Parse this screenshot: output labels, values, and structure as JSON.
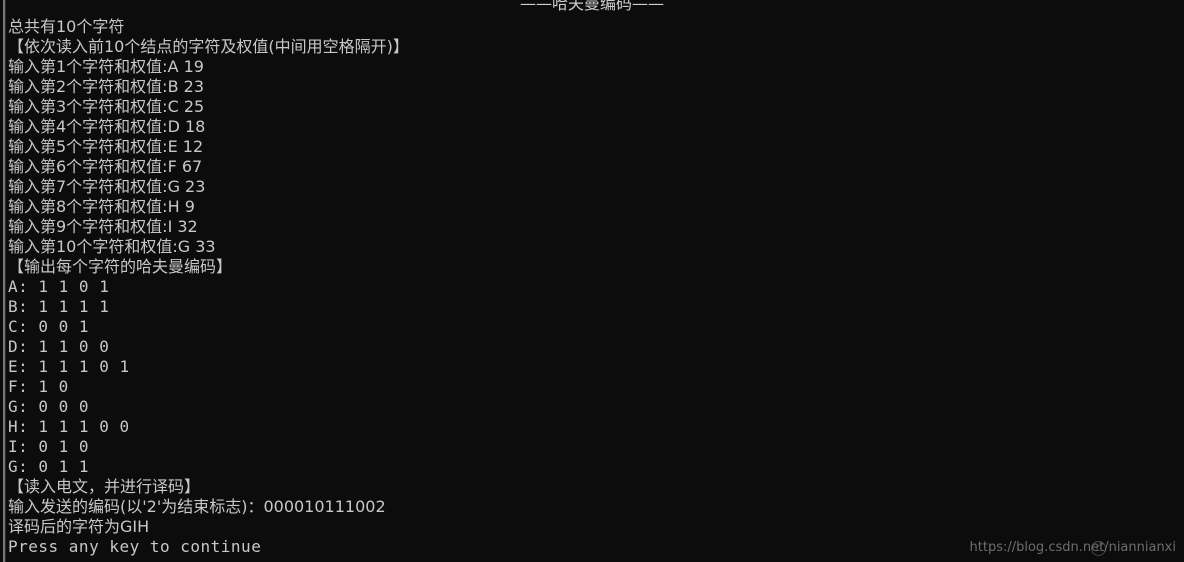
{
  "console": {
    "title": "——哈夫曼编码——",
    "background_color": "#0c0c0c",
    "text_color": "#c8c8c8",
    "lines": [
      {
        "text": "总共有10个字符",
        "mono": false
      },
      {
        "text": "【依次读入前10个结点的字符及权值(中间用空格隔开)】",
        "mono": false
      },
      {
        "text": "输入第1个字符和权值:A 19",
        "mono": false
      },
      {
        "text": "输入第2个字符和权值:B 23",
        "mono": false
      },
      {
        "text": "输入第3个字符和权值:C 25",
        "mono": false
      },
      {
        "text": "输入第4个字符和权值:D 18",
        "mono": false
      },
      {
        "text": "输入第5个字符和权值:E 12",
        "mono": false
      },
      {
        "text": "输入第6个字符和权值:F 67",
        "mono": false
      },
      {
        "text": "输入第7个字符和权值:G 23",
        "mono": false
      },
      {
        "text": "输入第8个字符和权值:H 9",
        "mono": false
      },
      {
        "text": "输入第9个字符和权值:I 32",
        "mono": false
      },
      {
        "text": "输入第10个字符和权值:G 33",
        "mono": false
      },
      {
        "text": "【输出每个字符的哈夫曼编码】",
        "mono": false
      },
      {
        "text": "A: 1 1 0 1",
        "mono": true
      },
      {
        "text": "B: 1 1 1 1",
        "mono": true
      },
      {
        "text": "C: 0 0 1",
        "mono": true
      },
      {
        "text": "D: 1 1 0 0",
        "mono": true
      },
      {
        "text": "E: 1 1 1 0 1",
        "mono": true
      },
      {
        "text": "F: 1 0",
        "mono": true
      },
      {
        "text": "G: 0 0 0",
        "mono": true
      },
      {
        "text": "H: 1 1 1 0 0",
        "mono": true
      },
      {
        "text": "I: 0 1 0",
        "mono": true
      },
      {
        "text": "G: 0 1 1",
        "mono": true
      },
      {
        "text": "【读入电文，并进行译码】",
        "mono": false
      },
      {
        "text": "输入发送的编码(以'2'为结束标志)：000010111002",
        "mono": false
      },
      {
        "text": "译码后的字符为GIH",
        "mono": false
      },
      {
        "text": "Press any key to continue",
        "mono": true
      }
    ],
    "prompt": "Press any key to continue"
  },
  "program": {
    "character_count": "10",
    "characters": [
      {
        "index": "1",
        "char": "A",
        "weight": "19",
        "code": "1 1 0 1"
      },
      {
        "index": "2",
        "char": "B",
        "weight": "23",
        "code": "1 1 1 1"
      },
      {
        "index": "3",
        "char": "C",
        "weight": "25",
        "code": "0 0 1"
      },
      {
        "index": "4",
        "char": "D",
        "weight": "18",
        "code": "1 1 0 0"
      },
      {
        "index": "5",
        "char": "E",
        "weight": "12",
        "code": "1 1 1 0 1"
      },
      {
        "index": "6",
        "char": "F",
        "weight": "67",
        "code": "1 0"
      },
      {
        "index": "7",
        "char": "G",
        "weight": "23",
        "code": "0 0 0"
      },
      {
        "index": "8",
        "char": "H",
        "weight": "9",
        "code": "1 1 1 0 0"
      },
      {
        "index": "9",
        "char": "I",
        "weight": "32",
        "code": "0 1 0"
      },
      {
        "index": "10",
        "char": "G",
        "weight": "33",
        "code": "0 1 1"
      }
    ],
    "encoded_input": "000010111002",
    "decoded_output": "GIH",
    "terminator": "2"
  },
  "watermark": {
    "text": "https://blog.csdn.net/niannianxi",
    "logo_label": "C"
  }
}
